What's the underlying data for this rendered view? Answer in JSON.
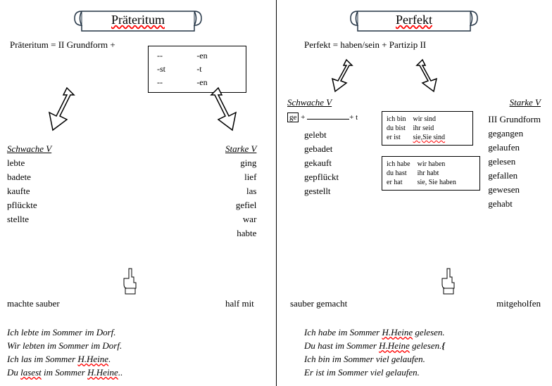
{
  "left": {
    "title": "Präteritum",
    "formula": "Präteritum = II Grundform +",
    "endings": [
      [
        "--",
        "-en"
      ],
      [
        "-st",
        "-t"
      ],
      [
        "--",
        "-en"
      ]
    ],
    "schwache_heading": "Schwache V",
    "starke_heading": "Starke V",
    "schwache": [
      "lebte",
      "badete",
      "kaufte",
      "pflückte",
      "stellte"
    ],
    "starke": [
      "ging",
      "lief",
      "las",
      "gefiel",
      "war",
      "habte"
    ],
    "extra_left": "machte sauber",
    "extra_right": "half mit",
    "sentences": [
      "Ich lebte im Sommer im Dorf.",
      "Wir lebten im Sommer im Dorf.",
      "Ich las im Sommer H.Heine.",
      "Du lasest im Sommer H.Heine.."
    ]
  },
  "right": {
    "title": "Perfekt",
    "formula": "Perfekt = haben/sein + Partizip II",
    "schwache_heading": "Schwache V",
    "starke_heading": "Starke V",
    "ge_prefix": "ge",
    "ge_suffix": "+ t",
    "schwache": [
      "gelebt",
      "gebadet",
      "gekauft",
      "gepflückt",
      "gestellt"
    ],
    "starke_head": "III Grundform",
    "starke": [
      "gegangen",
      "gelaufen",
      "gelesen",
      "gefallen",
      "gewesen",
      "gehabt"
    ],
    "sein_conj": [
      [
        "ich bin",
        "wir sind"
      ],
      [
        "du bist",
        "ihr seid"
      ],
      [
        "er ist",
        "sie,Sie sind"
      ]
    ],
    "haben_conj": [
      [
        "ich habe",
        "wir haben"
      ],
      [
        "du hast",
        "ihr habt"
      ],
      [
        "er hat",
        "sie, Sie haben"
      ]
    ],
    "extra_left": "sauber gemacht",
    "extra_right": "mitgeholfen",
    "sentences": [
      "Ich habe im Sommer H.Heine gelesen.",
      "Du hast im Sommer H.Heine gelesen.",
      "Ich bin im Sommer viel gelaufen.",
      "Er ist im Sommer viel gelaufen."
    ]
  }
}
